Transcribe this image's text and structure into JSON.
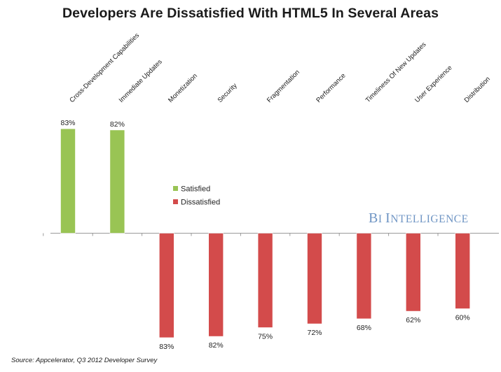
{
  "chart_data": {
    "type": "bar",
    "title": "Developers Are Dissatisfied With HTML5 In Several Areas",
    "categories": [
      "Cross-Development Capabilities",
      "Immediate Updates",
      "Monetization",
      "Security",
      "Fragmentation",
      "Performance",
      "Timeliness Of New Updates",
      "User Experience",
      "Distribution"
    ],
    "series": [
      {
        "name": "Satisfied",
        "color": "#99c454",
        "values": [
          83,
          82,
          null,
          null,
          null,
          null,
          null,
          null,
          null
        ],
        "labels": [
          "83%",
          "82%",
          "",
          "",
          "",
          "",
          "",
          "",
          ""
        ]
      },
      {
        "name": "Dissatisfied",
        "color": "#d34b4b",
        "values": [
          null,
          null,
          83,
          82,
          75,
          72,
          68,
          62,
          60
        ],
        "labels": [
          "",
          "",
          "83%",
          "82%",
          "75%",
          "72%",
          "68%",
          "62%",
          "60%"
        ]
      }
    ],
    "ylim": [
      -100,
      100
    ],
    "grid": false,
    "legend": {
      "position": "center"
    }
  },
  "watermark": {
    "first_big": "B",
    "first_small": "I",
    "second_big": "I",
    "second_small": "NTELLIGENCE"
  },
  "source": "Source: Appcelerator, Q3 2012 Developer Survey"
}
